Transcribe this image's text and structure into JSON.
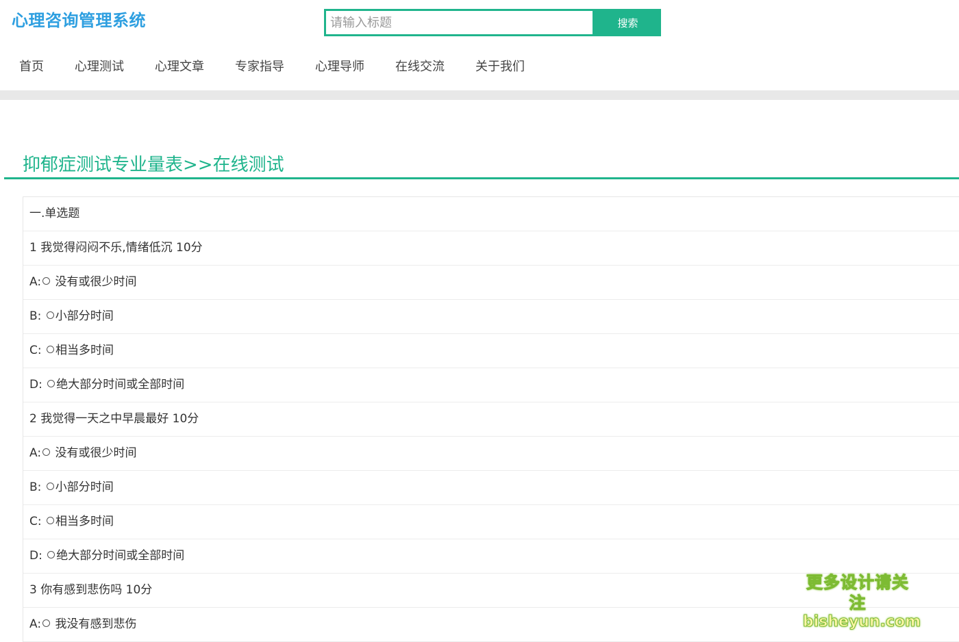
{
  "header": {
    "logo": "心理咨询管理系统",
    "search": {
      "placeholder": "请输入标题",
      "button": "搜索"
    }
  },
  "nav": {
    "items": [
      "首页",
      "心理测试",
      "心理文章",
      "专家指导",
      "心理导师",
      "在线交流",
      "关于我们"
    ]
  },
  "main": {
    "title": "抑郁症测试专业量表>>在线测试",
    "section": "一.单选题",
    "rows": [
      {
        "type": "q",
        "text": "1 我觉得闷闷不乐,情绪低沉 10分"
      },
      {
        "type": "opt",
        "prefix": "A:",
        "text": " 没有或很少时间"
      },
      {
        "type": "opt",
        "prefix": "B: ",
        "text": "小部分时间"
      },
      {
        "type": "opt",
        "prefix": "C: ",
        "text": "相当多时间"
      },
      {
        "type": "opt",
        "prefix": "D: ",
        "text": "绝大部分时间或全部时间"
      },
      {
        "type": "q",
        "text": "2 我觉得一天之中早晨最好 10分"
      },
      {
        "type": "opt",
        "prefix": "A:",
        "text": " 没有或很少时间"
      },
      {
        "type": "opt",
        "prefix": "B: ",
        "text": "小部分时间"
      },
      {
        "type": "opt",
        "prefix": "C: ",
        "text": "相当多时间"
      },
      {
        "type": "opt",
        "prefix": "D: ",
        "text": "绝大部分时间或全部时间"
      },
      {
        "type": "q",
        "text": "3 你有感到悲伤吗 10分"
      },
      {
        "type": "opt",
        "prefix": "A:",
        "text": " 我没有感到悲伤"
      }
    ]
  },
  "watermark": {
    "line1": "更多设计请关注",
    "line2": "bisheyun.com"
  },
  "colors": {
    "accent": "#1fb48c",
    "logo": "#2e9fe0"
  }
}
